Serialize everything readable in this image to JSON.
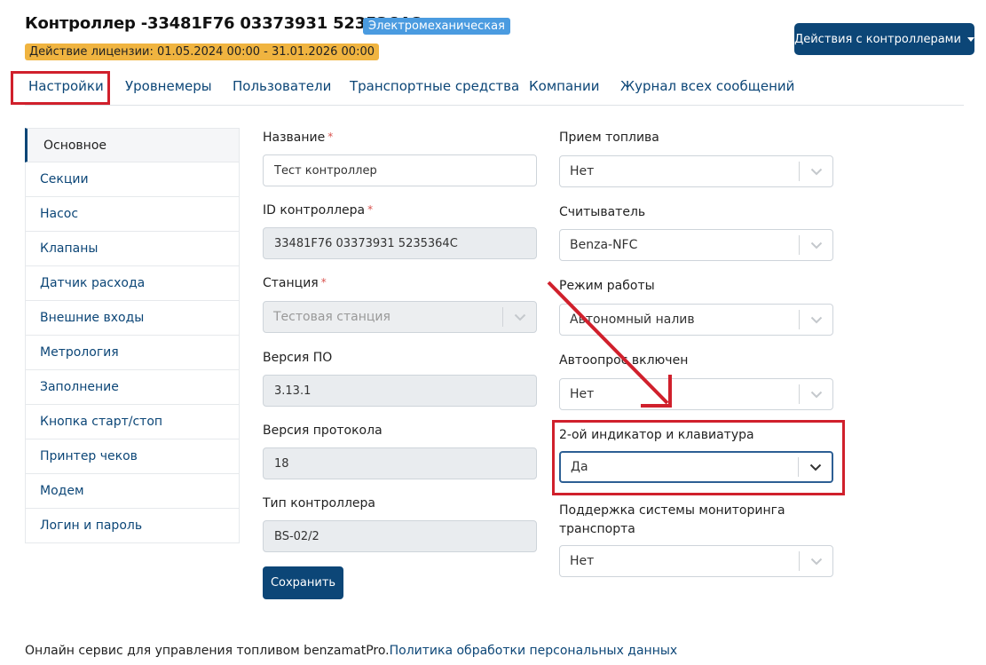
{
  "header": {
    "title": "Контроллер -33481F76 03373931 5235364C",
    "type_badge": "Электромеханическая",
    "license_badge": "Действие лицензии: 01.05.2024 00:00 - 31.01.2026 00:00",
    "actions_button": "Действия с контроллерами"
  },
  "tabs": [
    {
      "label": "Настройки"
    },
    {
      "label": "Уровнемеры"
    },
    {
      "label": "Пользователи"
    },
    {
      "label": "Транспортные средства"
    },
    {
      "label": "Компании"
    },
    {
      "label": "Журнал всех сообщений"
    }
  ],
  "sidebar": {
    "items": [
      {
        "label": "Основное"
      },
      {
        "label": "Секции"
      },
      {
        "label": "Насос"
      },
      {
        "label": "Клапаны"
      },
      {
        "label": "Датчик расхода"
      },
      {
        "label": "Внешние входы"
      },
      {
        "label": "Метрология"
      },
      {
        "label": "Заполнение"
      },
      {
        "label": "Кнопка старт/стоп"
      },
      {
        "label": "Принтер чеков"
      },
      {
        "label": "Модем"
      },
      {
        "label": "Логин и пароль"
      }
    ]
  },
  "form_left": {
    "name": {
      "label": "Название",
      "required": "*",
      "value": "Тест контроллер"
    },
    "controller_id": {
      "label": "ID контроллера",
      "required": "*",
      "value": "33481F76 03373931 5235364C"
    },
    "station": {
      "label": "Станция",
      "required": "*",
      "value": "Тестовая станция"
    },
    "fw_version": {
      "label": "Версия ПО",
      "value": "3.13.1"
    },
    "protocol_version": {
      "label": "Версия протокола",
      "value": "18"
    },
    "controller_type": {
      "label": "Тип контроллера",
      "value": "BS-02/2"
    },
    "save_button": "Сохранить"
  },
  "form_right": {
    "fuel_intake": {
      "label": "Прием топлива",
      "value": "Нет"
    },
    "reader": {
      "label": "Считыватель",
      "value": "Benza-NFC"
    },
    "mode": {
      "label": "Режим работы",
      "value": "Автономный налив"
    },
    "autopoll": {
      "label": "Автоопрос включен",
      "value": "Нет"
    },
    "second_indicator": {
      "label": "2-ой индикатор и клавиатура",
      "value": "Да"
    },
    "monitoring": {
      "label_line1": "Поддержка системы мониторинга",
      "label_line2": "транспорта",
      "value": "Нет"
    }
  },
  "footer": {
    "text": "Онлайн сервис для управления топливом benzamatPro.",
    "link": "Политика обработки персональных данных"
  },
  "colors": {
    "primary": "#0c4677",
    "badge_blue": "#4a9be0",
    "badge_orange": "#f0b440",
    "annotation_red": "#d0202c"
  }
}
